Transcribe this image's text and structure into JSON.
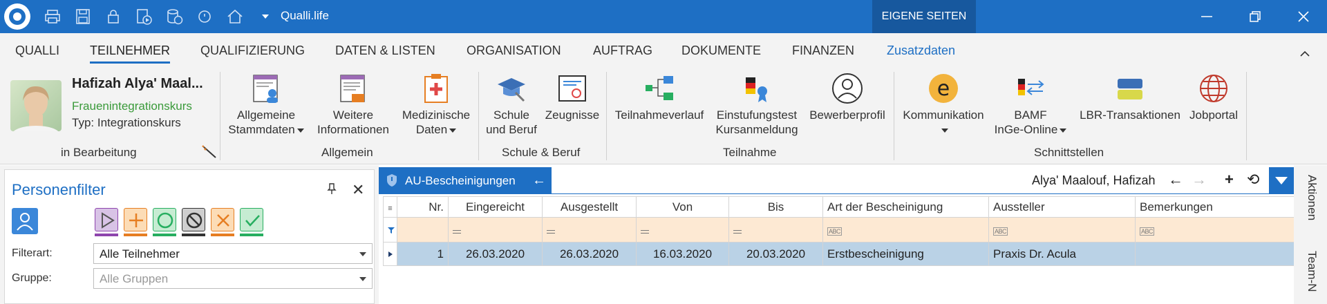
{
  "titlebar": {
    "app_title": "Qualli.life",
    "eigene_seiten": "EIGENE SEITEN",
    "quick_access": [
      "print-icon",
      "save-icon",
      "lock-icon",
      "document-play-icon",
      "database-play-icon",
      "refresh-icon",
      "home-icon",
      "dropdown-icon"
    ]
  },
  "tabs": [
    "QUALLI",
    "TEILNEHMER",
    "QUALIFIZIERUNG",
    "DATEN & LISTEN",
    "ORGANISATION",
    "AUFTRAG",
    "DOKUMENTE",
    "FINANZEN",
    "Zusatzdaten"
  ],
  "person": {
    "name": "Hafizah Alya' Maal...",
    "course": "Frauenintegrationskurs",
    "type": "Typ: Integrationskurs",
    "group_label": "in Bearbeitung"
  },
  "groups": {
    "allgemein": {
      "label": "Allgemein",
      "buttons": [
        {
          "line1": "Allgemeine",
          "line2": "Stammdaten"
        },
        {
          "line1": "Weitere",
          "line2": "Informationen"
        },
        {
          "line1": "Medizinische",
          "line2": "Daten"
        }
      ]
    },
    "schule": {
      "label": "Schule & Beruf",
      "buttons": [
        {
          "line1": "Schule",
          "line2": "und Beruf"
        },
        {
          "line1": "Zeugnisse",
          "line2": ""
        }
      ]
    },
    "teilnahme": {
      "label": "Teilnahme",
      "buttons": [
        {
          "line1": "Teilnahmeverlauf",
          "line2": ""
        },
        {
          "line1": "Einstufungstest",
          "line2": "Kursanmeldung"
        },
        {
          "line1": "Bewerberprofil",
          "line2": ""
        }
      ]
    },
    "schnittstellen": {
      "label": "Schnittstellen",
      "buttons": [
        {
          "line1": "Kommunikation",
          "line2": ""
        },
        {
          "line1": "BAMF",
          "line2": "InGe-Online"
        },
        {
          "line1": "LBR-Transaktionen",
          "line2": ""
        },
        {
          "line1": "Jobportal",
          "line2": ""
        }
      ]
    }
  },
  "filter_panel": {
    "title": "Personenfilter",
    "filterart_label": "Filterart:",
    "filterart_value": "Alle Teilnehmer",
    "gruppe_label": "Gruppe:",
    "gruppe_placeholder": "Alle Gruppen",
    "buttons": [
      {
        "icon": "play-icon",
        "color": "#8e44ad"
      },
      {
        "icon": "plus-icon",
        "color": "#e67e22"
      },
      {
        "icon": "circle-icon",
        "color": "#27ae60"
      },
      {
        "icon": "block-icon",
        "color": "#333333"
      },
      {
        "icon": "x-icon",
        "color": "#e67e22"
      },
      {
        "icon": "check-icon",
        "color": "#27ae60"
      }
    ]
  },
  "document": {
    "tab_title": "AU-Bescheinigungen",
    "person_name": "Alya' Maalouf, Hafizah"
  },
  "grid": {
    "columns": [
      "Nr.",
      "Eingereicht",
      "Ausgestellt",
      "Von",
      "Bis",
      "Art der Bescheinigung",
      "Aussteller",
      "Bemerkungen"
    ],
    "rows": [
      {
        "nr": "1",
        "eingereicht": "26.03.2020",
        "ausgestellt": "26.03.2020",
        "von": "16.03.2020",
        "bis": "20.03.2020",
        "art": "Erstbescheinigung",
        "aussteller": "Praxis Dr. Acula",
        "bemerkungen": ""
      }
    ]
  },
  "side_tabs": [
    "Aktionen",
    "Team-N"
  ],
  "colors": {
    "accent": "#1e6fc4",
    "filter_row": "#fde9d3",
    "selected_row": "#bad2e6"
  }
}
